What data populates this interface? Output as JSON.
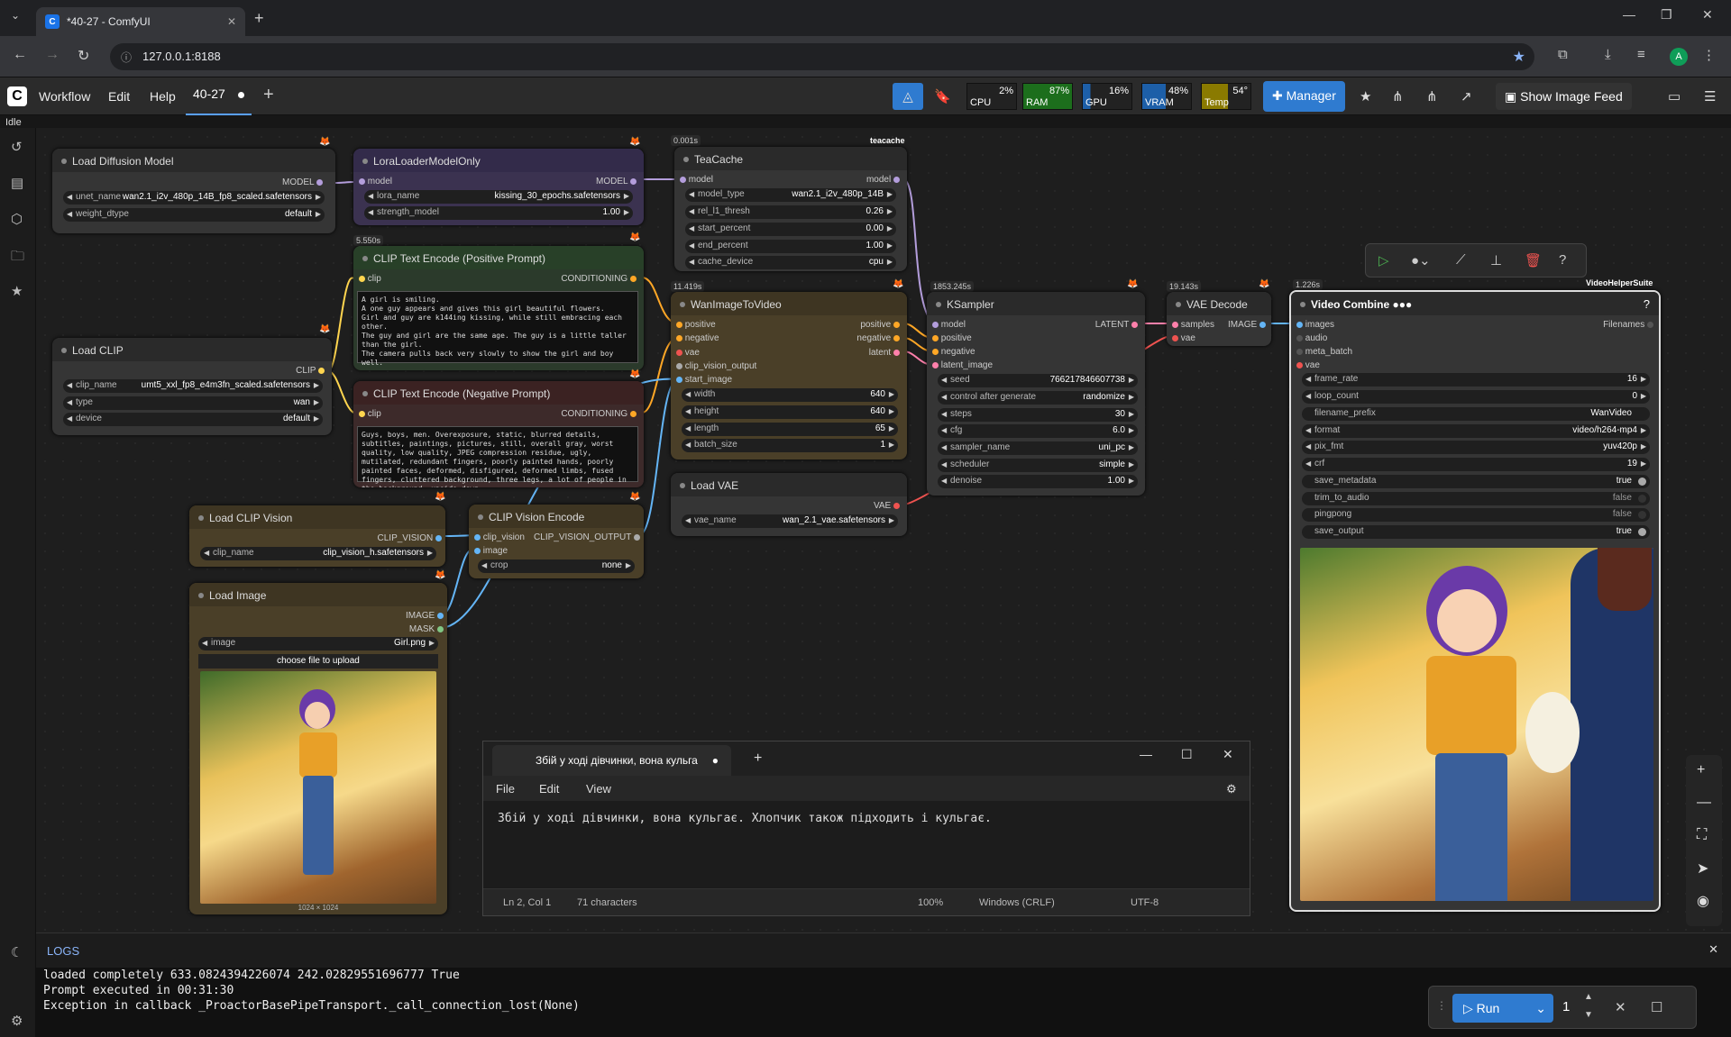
{
  "browser": {
    "tab_title": "*40-27 - ComfyUI",
    "url": "127.0.0.1:8188",
    "avatar": "A"
  },
  "menubar": {
    "items": [
      "Workflow",
      "Edit",
      "Help"
    ],
    "workflow_tab": "40-27",
    "manager": "Manager",
    "image_feed": "Show Image Feed",
    "status": "Idle"
  },
  "monitors": [
    {
      "label": "CPU",
      "value": "2%",
      "color": "#222"
    },
    {
      "label": "RAM",
      "value": "87%",
      "color": "#1c6e1c"
    },
    {
      "label": "GPU",
      "value": "16%",
      "color": "#1d5fa8"
    },
    {
      "label": "VRAM",
      "value": "48%",
      "color": "#1d5fa8"
    },
    {
      "label": "Temp",
      "value": "54°",
      "color": "#8a7a00"
    }
  ],
  "nodes": {
    "load_diffusion": {
      "title": "Load Diffusion Model",
      "out": "MODEL",
      "unet_name_l": "unet_name",
      "unet_name": "wan2.1_i2v_480p_14B_fp8_scaled.safetensors",
      "weight_dtype_l": "weight_dtype",
      "weight_dtype": "default"
    },
    "lora": {
      "title": "LoraLoaderModelOnly",
      "in": "model",
      "out": "MODEL",
      "lora_name_l": "lora_name",
      "lora_name": "kissing_30_epochs.safetensors",
      "strength_l": "strength_model",
      "strength": "1.00"
    },
    "teacache": {
      "title": "TeaCache",
      "badge": "0.001s",
      "tag": "teacache",
      "in": "model",
      "out": "model",
      "model_type_l": "model_type",
      "model_type": "wan2.1_i2v_480p_14B",
      "rel_l1_l": "rel_l1_thresh",
      "rel_l1": "0.26",
      "start_l": "start_percent",
      "start": "0.00",
      "end_l": "end_percent",
      "end": "1.00",
      "cache_l": "cache_device",
      "cache": "cpu"
    },
    "clip_pos": {
      "title": "CLIP Text Encode (Positive Prompt)",
      "badge": "5.550s",
      "in": "clip",
      "out": "CONDITIONING",
      "text": "A girl is smiling.\nA one guy appears and gives this girl beautiful flowers.\nGirl and guy are k144ing kissing, while still embracing each other.\nThe guy and girl are the same age. The guy is a little taller than the girl.\nThe camera pulls back very slowly to show the girl and boy well."
    },
    "clip_neg": {
      "title": "CLIP Text Encode (Negative Prompt)",
      "in": "clip",
      "out": "CONDITIONING",
      "text": "Guys, boys, men. Overexposure, static, blurred details, subtitles, paintings, pictures, still, overall gray, worst quality, low quality, JPEG compression residue, ugly, mutilated, redundant fingers, poorly painted hands, poorly painted faces, deformed, disfigured, deformed limbs, fused fingers, cluttered background, three legs, a lot of people in the background, upside down"
    },
    "load_clip": {
      "title": "Load CLIP",
      "out": "CLIP",
      "clip_name_l": "clip_name",
      "clip_name": "umt5_xxl_fp8_e4m3fn_scaled.safetensors",
      "type_l": "type",
      "type": "wan",
      "device_l": "device",
      "device": "default"
    },
    "wan": {
      "title": "WanImageToVideo",
      "badge": "11.419s",
      "ins": [
        "positive",
        "negative",
        "vae",
        "clip_vision_output",
        "start_image"
      ],
      "outs": [
        "positive",
        "negative",
        "latent"
      ],
      "width_l": "width",
      "width": "640",
      "height_l": "height",
      "height": "640",
      "length_l": "length",
      "length": "65",
      "batch_l": "batch_size",
      "batch": "1"
    },
    "ksampler": {
      "title": "KSampler",
      "badge": "1853.245s",
      "ins": [
        "model",
        "positive",
        "negative",
        "latent_image"
      ],
      "out": "LATENT",
      "seed_l": "seed",
      "seed": "766217846607738",
      "cag_l": "control after generate",
      "cag": "randomize",
      "steps_l": "steps",
      "steps": "30",
      "cfg_l": "cfg",
      "cfg": "6.0",
      "sampler_l": "sampler_name",
      "sampler": "uni_pc",
      "sched_l": "scheduler",
      "sched": "simple",
      "denoise_l": "denoise",
      "denoise": "1.00"
    },
    "vae_decode": {
      "title": "VAE Decode",
      "badge": "19.143s",
      "ins": [
        "samples",
        "vae"
      ],
      "out": "IMAGE"
    },
    "load_vae": {
      "title": "Load VAE",
      "out": "VAE",
      "vae_name_l": "vae_name",
      "vae_name": "wan_2.1_vae.safetensors"
    },
    "clip_vision": {
      "title": "Load CLIP Vision",
      "out": "CLIP_VISION",
      "clip_name_l": "clip_name",
      "clip_name": "clip_vision_h.safetensors"
    },
    "clip_vision_enc": {
      "title": "CLIP Vision Encode",
      "ins": [
        "clip_vision",
        "image"
      ],
      "out": "CLIP_VISION_OUTPUT",
      "crop_l": "crop",
      "crop": "none"
    },
    "load_image": {
      "title": "Load Image",
      "outs": [
        "IMAGE",
        "MASK"
      ],
      "image_l": "image",
      "image": "Girl.png",
      "upload": "choose file to upload",
      "dims": "1024 × 1024"
    },
    "video_combine": {
      "title": "Video Combine",
      "badge": "1.226s",
      "tag": "VideoHelperSuite",
      "ins": [
        "images",
        "audio",
        "meta_batch",
        "vae"
      ],
      "out": "Filenames",
      "frame_rate_l": "frame_rate",
      "frame_rate": "16",
      "loop_l": "loop_count",
      "loop": "0",
      "prefix_l": "filename_prefix",
      "prefix": "WanVideo",
      "format_l": "format",
      "format": "video/h264-mp4",
      "pix_l": "pix_fmt",
      "pix": "yuv420p",
      "crf_l": "crf",
      "crf": "19",
      "save_meta_l": "save_metadata",
      "save_meta": "true",
      "trim_l": "trim_to_audio",
      "trim": "false",
      "ping_l": "pingpong",
      "ping": "false",
      "save_out_l": "save_output",
      "save_out": "true"
    }
  },
  "notepad": {
    "tab": "Збій у ході дівчинки, вона кульга",
    "menu": [
      "File",
      "Edit",
      "View"
    ],
    "text": "Збій у ході дівчинки, вона кульгає. Хлопчик також підходить і кульгає.",
    "pos": "Ln 2, Col 1",
    "chars": "71 characters",
    "zoom": "100%",
    "eol": "Windows (CRLF)",
    "enc": "UTF-8"
  },
  "logs": {
    "title": "LOGS",
    "lines": [
      "loaded completely 633.0824394226074 242.02829551696777 True",
      "Prompt executed in 00:31:30",
      "Exception in callback _ProactorBasePipeTransport._call_connection_lost(None)"
    ]
  },
  "run": {
    "label": "Run",
    "count": "1"
  }
}
